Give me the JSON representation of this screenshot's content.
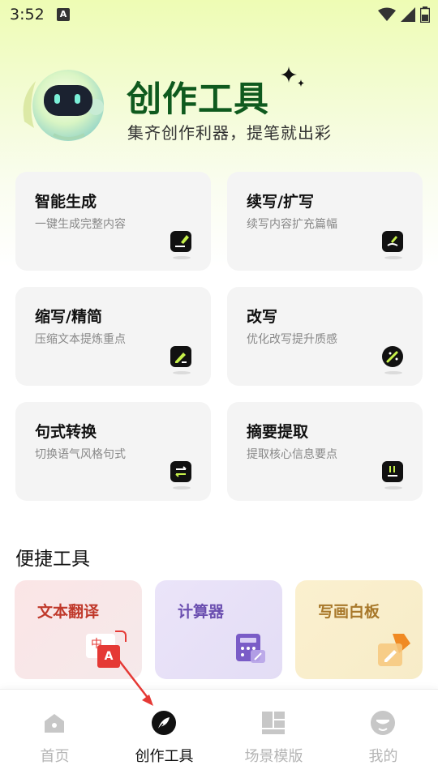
{
  "status_bar": {
    "time": "3:52",
    "notification_letter": "A"
  },
  "header": {
    "title": "创作工具",
    "subtitle": "集齐创作利器，提笔就出彩"
  },
  "features": [
    {
      "title": "智能生成",
      "desc": "一键生成完整内容",
      "icon": "edit-pencil-icon"
    },
    {
      "title": "续写/扩写",
      "desc": "续写内容扩充篇幅",
      "icon": "continue-write-icon"
    },
    {
      "title": "缩写/精简",
      "desc": "压缩文本提炼重点",
      "icon": "shorten-icon"
    },
    {
      "title": "改写",
      "desc": "优化改写提升质感",
      "icon": "magic-wand-icon"
    },
    {
      "title": "句式转换",
      "desc": "切换语气风格句式",
      "icon": "swap-arrows-icon"
    },
    {
      "title": "摘要提取",
      "desc": "提取核心信息要点",
      "icon": "summary-icon"
    }
  ],
  "quick_tools": {
    "title": "便捷工具",
    "items": [
      {
        "label": "文本翻译",
        "icon": "translate-icon",
        "icon_text_a": "中",
        "icon_text_b": "A",
        "color": "#c0392b"
      },
      {
        "label": "计算器",
        "icon": "calculator-icon",
        "color": "#6b4fb0"
      },
      {
        "label": "写画白板",
        "icon": "whiteboard-icon",
        "color": "#a8782a"
      }
    ]
  },
  "bottom_nav": {
    "active_index": 1,
    "items": [
      {
        "label": "首页",
        "icon": "home-icon"
      },
      {
        "label": "创作工具",
        "icon": "feather-icon"
      },
      {
        "label": "场景模版",
        "icon": "template-grid-icon"
      },
      {
        "label": "我的",
        "icon": "profile-icon"
      }
    ]
  },
  "colors": {
    "header_title": "#0f5a1e",
    "accent_lime": "#c6f04a",
    "arrow_annotation": "#e53935"
  }
}
